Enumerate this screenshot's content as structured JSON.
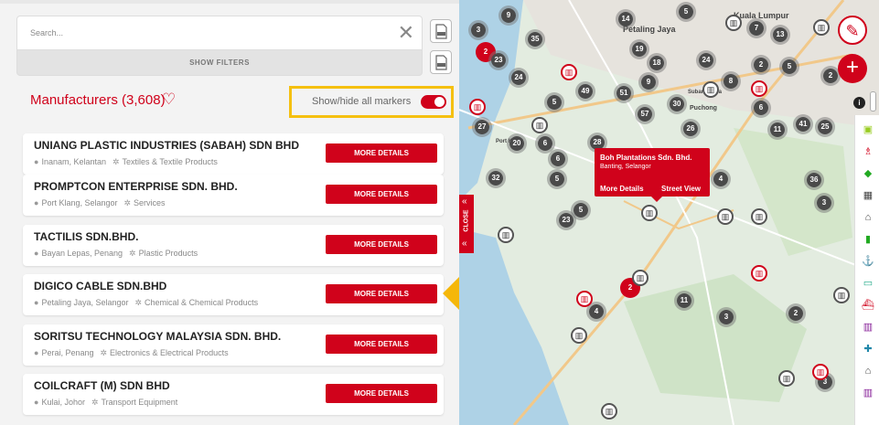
{
  "search": {
    "placeholder": "Search..."
  },
  "filters": {
    "label": "SHOW FILTERS"
  },
  "export_buttons": [
    {
      "icon": "pdf-file-icon"
    },
    {
      "icon": "excel-file-icon"
    }
  ],
  "header": {
    "title": "Manufacturers (3,608)",
    "toggle_label": "Show/hide all markers",
    "toggle_on": true
  },
  "manufacturers": [
    {
      "name": "UNIANG PLASTIC INDUSTRIES (SABAH) SDN BHD",
      "location": "Inanam, Kelantan",
      "category": "Textiles & Textile Products",
      "button": "MORE DETAILS"
    },
    {
      "name": "PROMPTCON ENTERPRISE SDN. BHD.",
      "location": "Port Klang, Selangor",
      "category": "Services",
      "button": "MORE DETAILS"
    },
    {
      "name": "TACTILIS SDN.BHD.",
      "location": "Bayan Lepas, Penang",
      "category": "Plastic Products",
      "button": "MORE DETAILS"
    },
    {
      "name": "DIGICO CABLE SDN.BHD",
      "location": "Petaling Jaya, Selangor",
      "category": "Chemical & Chemical Products",
      "button": "MORE DETAILS"
    },
    {
      "name": "SORITSU TECHNOLOGY MALAYSIA SDN. BHD.",
      "location": "Perai, Penang",
      "category": "Electronics & Electrical Products",
      "button": "MORE DETAILS"
    },
    {
      "name": "COILCRAFT (M) SDN BHD",
      "location": "Kulai, Johor",
      "category": "Transport Equipment",
      "button": "MORE DETAILS"
    }
  ],
  "map": {
    "close_label": "CLOSE",
    "popup": {
      "name": "Boh Plantations Sdn. Bhd.",
      "location": "Banting, Selangor",
      "more_details": "More Details",
      "street_view": "Street View"
    },
    "labels": [
      {
        "text": "Petaling Jaya"
      },
      {
        "text": "Kuala Lumpur"
      },
      {
        "text": "Port Klang"
      },
      {
        "text": "Puchong"
      },
      {
        "text": "Subang Jaya"
      }
    ],
    "clusters": [
      "9",
      "3",
      "14",
      "5",
      "7",
      "13",
      "2",
      "35",
      "23",
      "19",
      "24",
      "18",
      "2",
      "5",
      "2",
      "24",
      "5",
      "49",
      "51",
      "9",
      "8",
      "30",
      "6",
      "57",
      "26",
      "6",
      "41",
      "25",
      "27",
      "20",
      "6",
      "28",
      "11",
      "32",
      "5",
      "4",
      "36",
      "3",
      "5",
      "23",
      "2",
      "11",
      "4",
      "3",
      "2",
      "3"
    ],
    "info": "i",
    "accent_color": "#d0021b"
  }
}
